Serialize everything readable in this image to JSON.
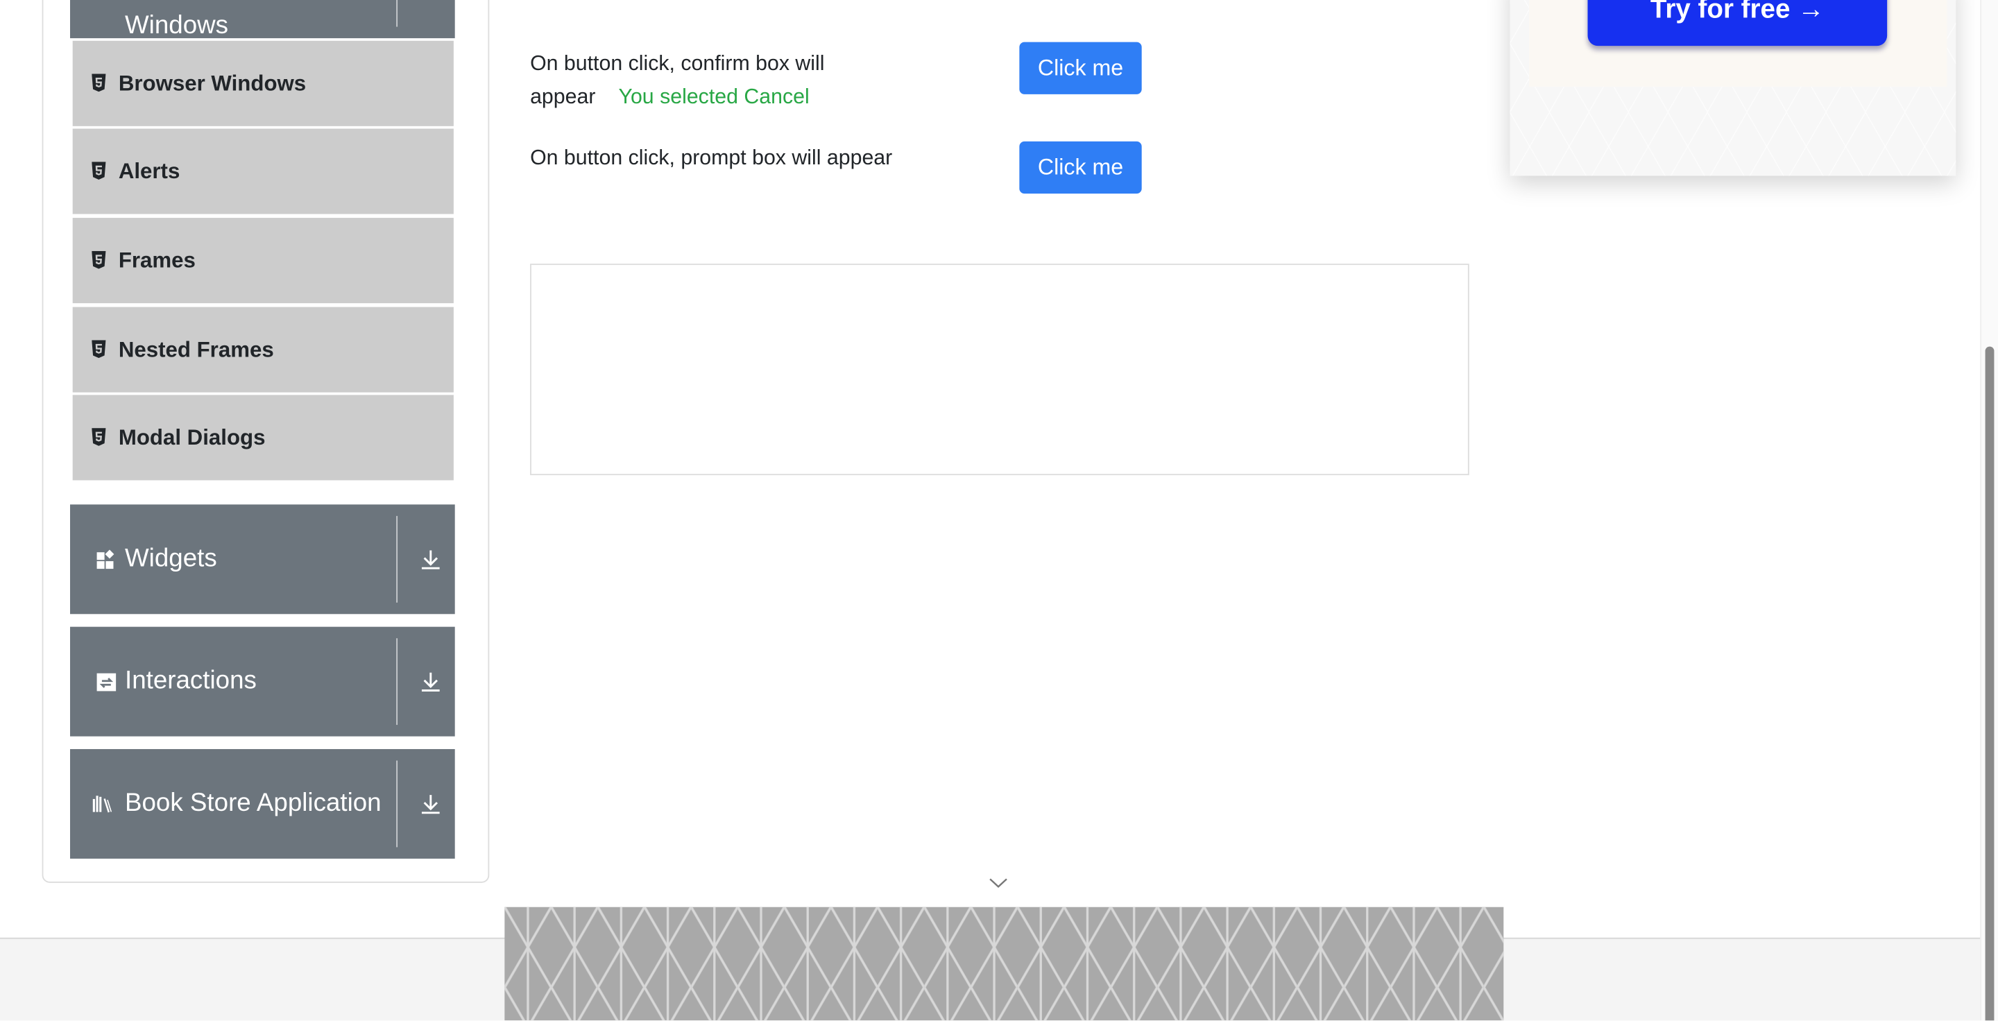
{
  "sidebar": {
    "current_group": {
      "label": "Windows"
    },
    "items": [
      {
        "label": "Browser Windows",
        "icon": "html5-icon"
      },
      {
        "label": "Alerts",
        "icon": "html5-icon"
      },
      {
        "label": "Frames",
        "icon": "html5-icon"
      },
      {
        "label": "Nested Frames",
        "icon": "html5-icon"
      },
      {
        "label": "Modal Dialogs",
        "icon": "html5-icon"
      }
    ],
    "groups": [
      {
        "label": "Widgets",
        "icon": "widgets-icon"
      },
      {
        "label": "Interactions",
        "icon": "interactions-icon"
      },
      {
        "label": "Book Store Application",
        "icon": "books-icon"
      }
    ]
  },
  "main": {
    "confirm": {
      "text_line1": "On button click, confirm box will",
      "text_line2": "appear",
      "result": "You selected Cancel",
      "button": "Click me"
    },
    "prompt": {
      "text": "On button click, prompt box will appear",
      "button": "Click me"
    }
  },
  "ad": {
    "button": "Try for free →"
  },
  "colors": {
    "accent": "#2f7ef5",
    "success": "#28a745",
    "group_bg": "#6c757d",
    "item_bg": "#cccccc"
  }
}
